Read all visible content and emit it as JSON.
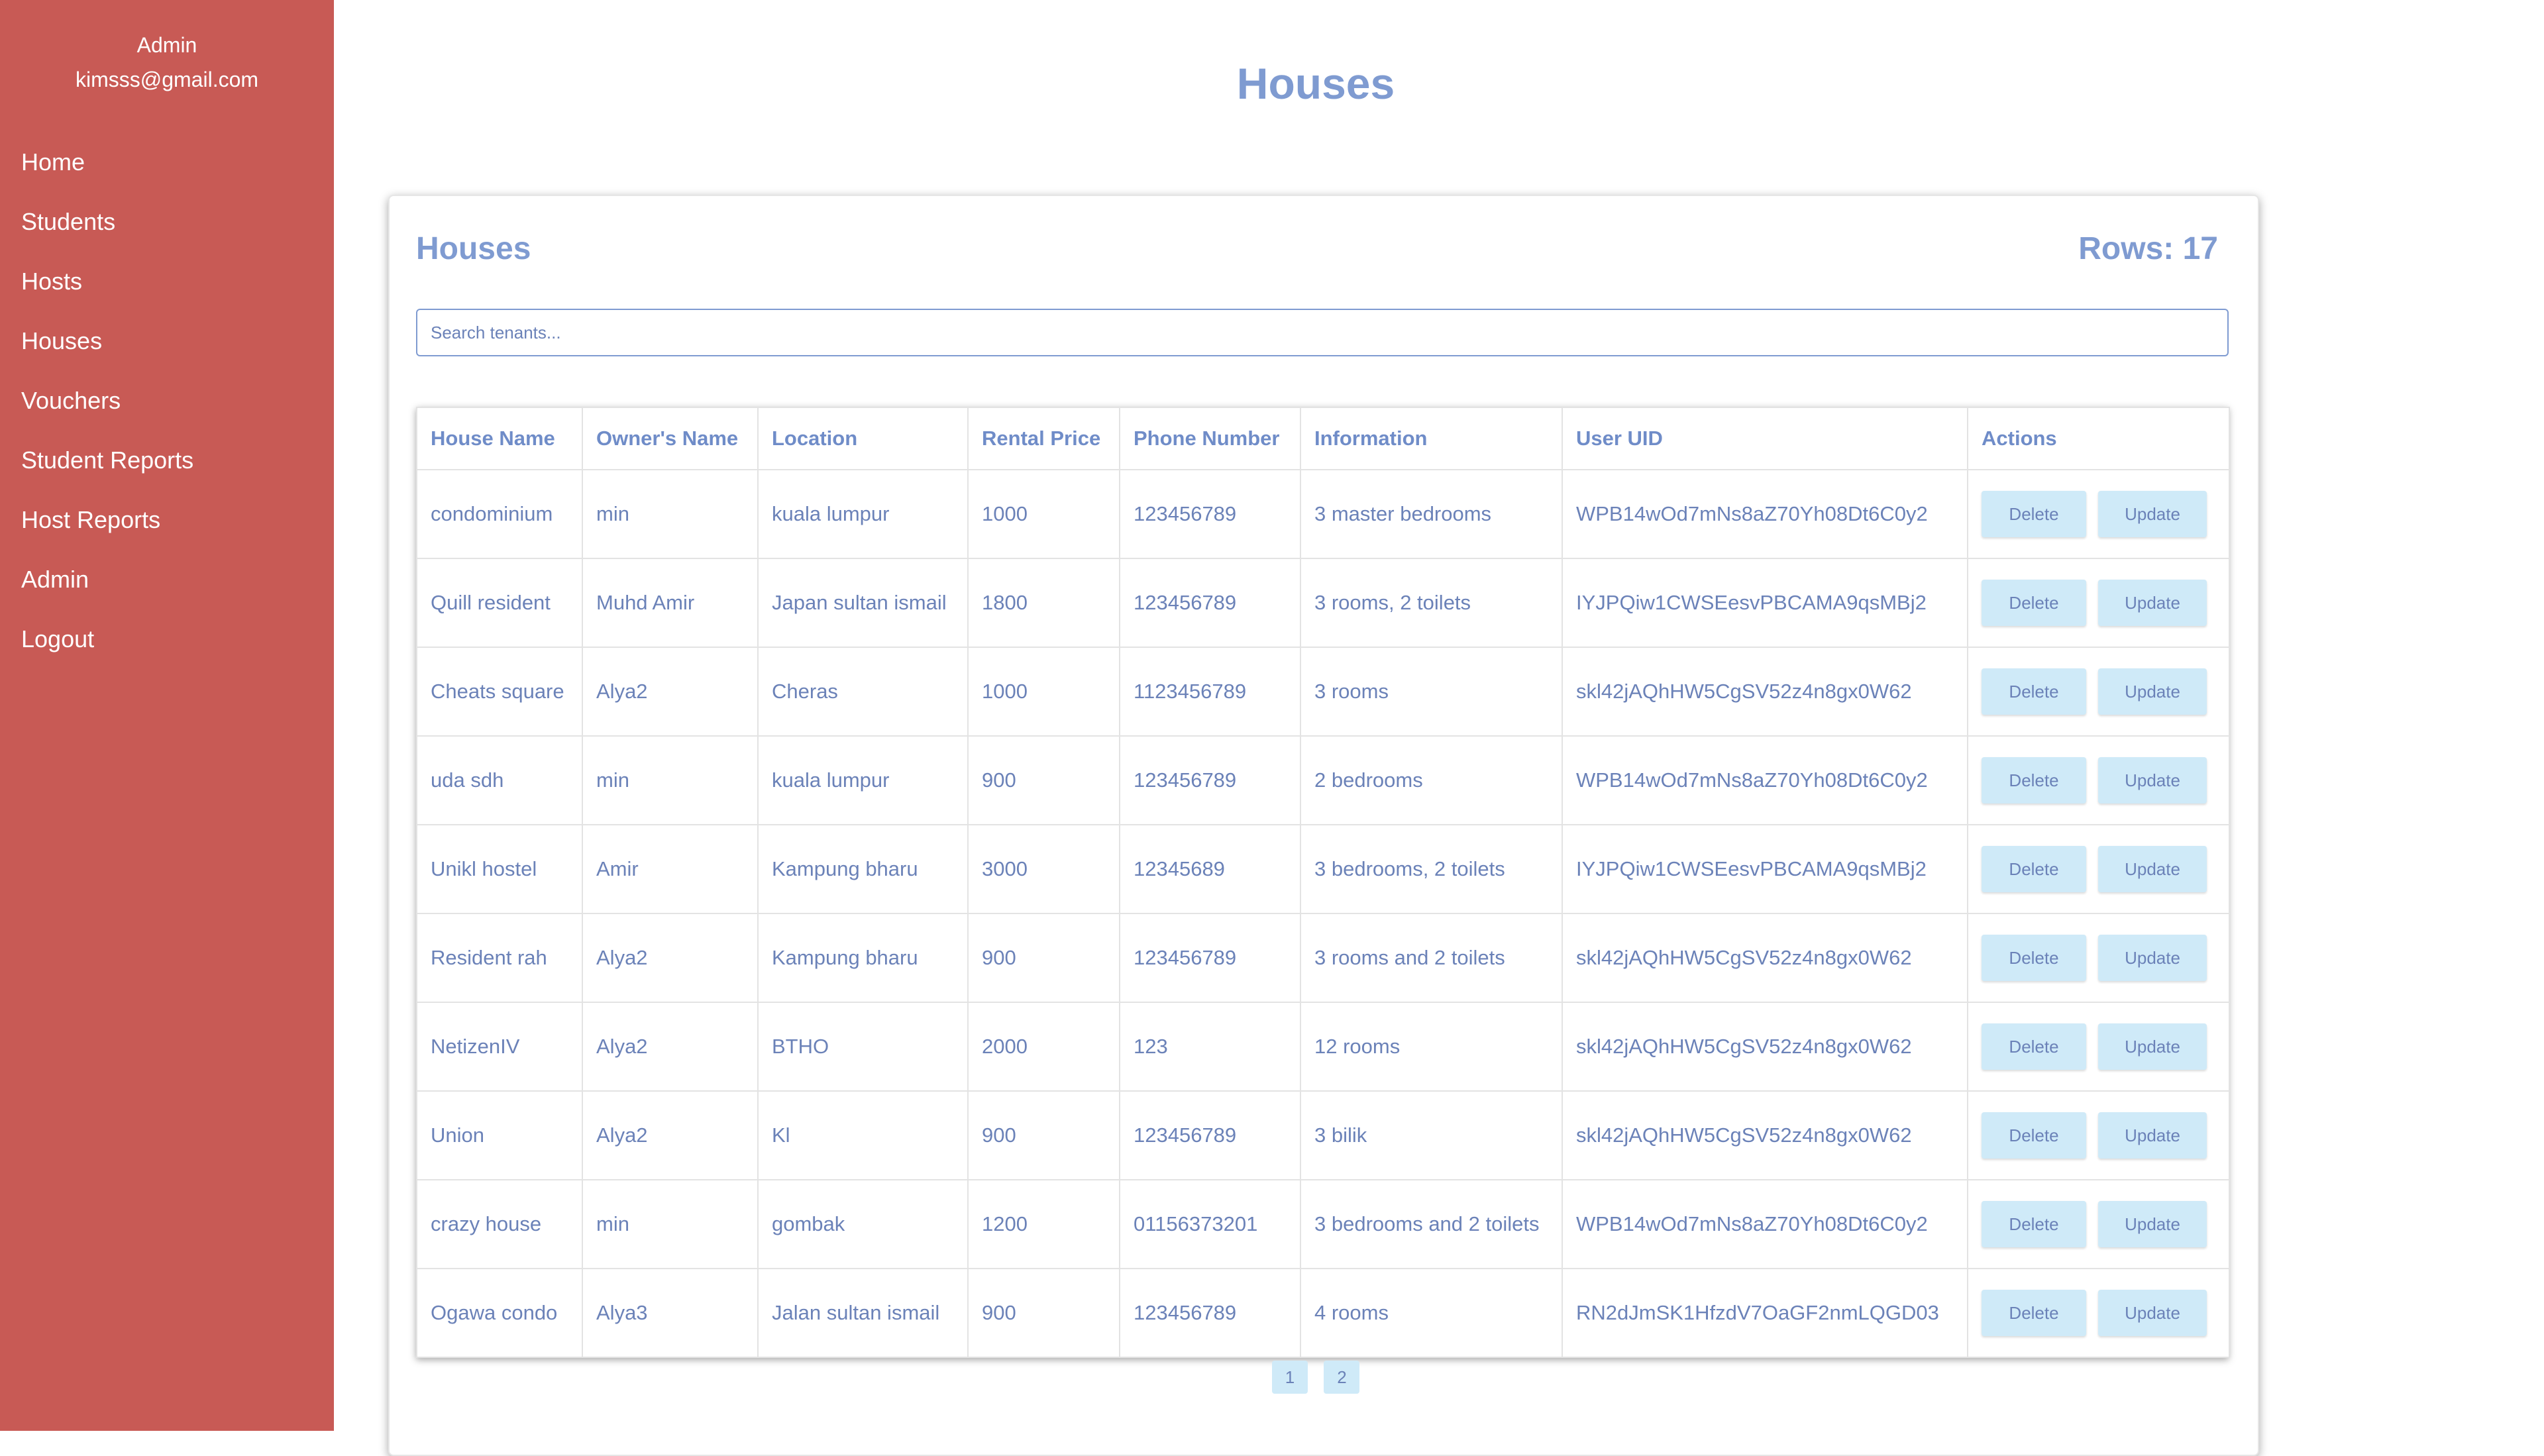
{
  "sidebar": {
    "role": "Admin",
    "email": "kimsss@gmail.com",
    "items": [
      {
        "label": "Home"
      },
      {
        "label": "Students"
      },
      {
        "label": "Hosts"
      },
      {
        "label": "Houses"
      },
      {
        "label": "Vouchers"
      },
      {
        "label": "Student Reports"
      },
      {
        "label": "Host Reports"
      },
      {
        "label": "Admin"
      },
      {
        "label": "Logout"
      }
    ]
  },
  "page": {
    "title": "Houses"
  },
  "card": {
    "title": "Houses",
    "rows_label": "Rows: 17",
    "search_placeholder": "Search tenants..."
  },
  "table": {
    "headers": [
      "House Name",
      "Owner's Name",
      "Location",
      "Rental Price",
      "Phone Number",
      "Information",
      "User UID",
      "Actions"
    ],
    "rows": [
      [
        "condominium",
        "min",
        "kuala lumpur",
        "1000",
        "123456789",
        "3 master bedrooms",
        "WPB14wOd7mNs8aZ70Yh08Dt6C0y2"
      ],
      [
        "Quill resident",
        "Muhd Amir",
        "Japan sultan ismail",
        "1800",
        "123456789",
        "3 rooms, 2 toilets",
        "IYJPQiw1CWSEesvPBCAMA9qsMBj2"
      ],
      [
        "Cheats square",
        "Alya2",
        "Cheras",
        "1000",
        "1123456789",
        "3 rooms",
        "skl42jAQhHW5CgSV52z4n8gx0W62"
      ],
      [
        "uda sdh",
        "min",
        "kuala lumpur",
        "900",
        "123456789",
        "2 bedrooms",
        "WPB14wOd7mNs8aZ70Yh08Dt6C0y2"
      ],
      [
        "Unikl hostel",
        "Amir",
        "Kampung bharu",
        "3000",
        "12345689",
        "3 bedrooms, 2 toilets",
        "IYJPQiw1CWSEesvPBCAMA9qsMBj2"
      ],
      [
        "Resident rah",
        "Alya2",
        "Kampung bharu",
        "900",
        "123456789",
        "3 rooms and 2 toilets",
        "skl42jAQhHW5CgSV52z4n8gx0W62"
      ],
      [
        "NetizenIV",
        "Alya2",
        "BTHO",
        "2000",
        "123",
        "12 rooms",
        "skl42jAQhHW5CgSV52z4n8gx0W62"
      ],
      [
        "Union",
        "Alya2",
        "Kl",
        "900",
        "123456789",
        "3 bilik",
        "skl42jAQhHW5CgSV52z4n8gx0W62"
      ],
      [
        "crazy house",
        "min",
        "gombak",
        "1200",
        "01156373201",
        "3 bedrooms and 2 toilets",
        "WPB14wOd7mNs8aZ70Yh08Dt6C0y2"
      ],
      [
        "Ogawa condo",
        "Alya3",
        "Jalan sultan ismail",
        "900",
        "123456789",
        "4 rooms",
        "RN2dJmSK1HfzdV7OaGF2nmLQGD03"
      ]
    ],
    "delete_label": "Delete",
    "update_label": "Update"
  },
  "pagination": {
    "pages": [
      "1",
      "2"
    ]
  },
  "colors": {
    "sidebar_bg": "#c85a55",
    "accent_text": "#7f9bd1",
    "button_bg": "#cfeaf8"
  }
}
